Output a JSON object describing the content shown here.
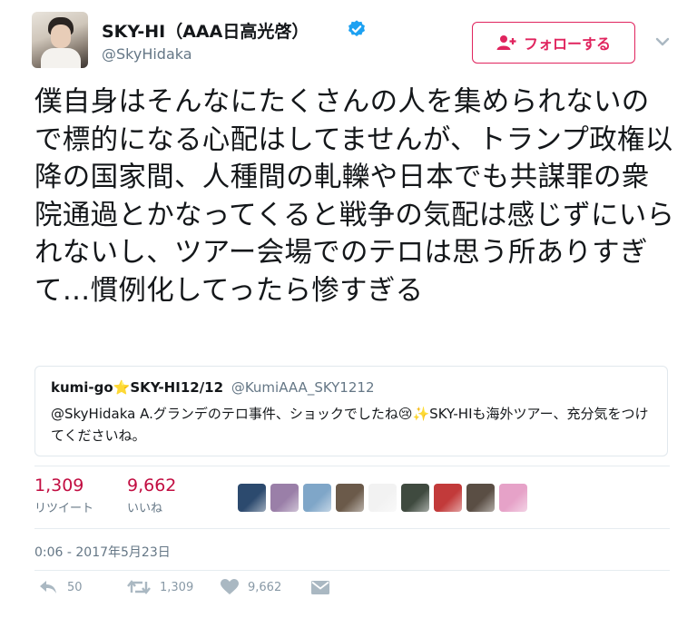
{
  "user": {
    "display_name": "SKY-HI（AAA日高光啓）",
    "handle": "@SkyHidaka",
    "verified_icon": "verified-badge-icon"
  },
  "follow_button": {
    "label": "フォローする",
    "icon": "add-user-icon"
  },
  "menu_icon": "chevron-down-icon",
  "tweet": {
    "text": "僕自身はそんなにたくさんの人を集められないので標的になる心配はしてませんが、トランプ政権以降の国家間、人種間の軋轢や日本でも共謀罪の衆院通過とかなってくると戦争の気配は感じずにいられないし、ツアー会場でのテロは思う所ありすぎて…慣例化してったら惨すぎる"
  },
  "quoted_tweet": {
    "name": "kumi-go⭐SKY-HI12/12",
    "handle": "@KumiAAA_SKY1212",
    "text": "@SkyHidaka A.グランデのテロ事件、ショックでしたね😢✨SKY-HIも海外ツアー、充分気をつけてくださいね。"
  },
  "stats": {
    "retweets": {
      "count": "1,309",
      "label": "リツイート"
    },
    "likes": {
      "count": "9,662",
      "label": "いいね"
    }
  },
  "liked_by_colors": [
    "#2c4a6e",
    "#9a7fa8",
    "#7fa6c8",
    "#6b5a4a",
    "#f2f2f2",
    "#3f4a3f",
    "#c23a3a",
    "#5a4e44",
    "#e6a2c8"
  ],
  "timestamp": "0:06 - 2017年5月23日",
  "actions": {
    "reply": {
      "icon": "reply-icon",
      "count": "50"
    },
    "retweet": {
      "icon": "retweet-icon",
      "count": "1,309"
    },
    "like": {
      "icon": "heart-icon",
      "count": "9,662"
    },
    "dm": {
      "icon": "envelope-icon"
    }
  },
  "colors": {
    "accent": "#e0245e",
    "stat_number": "#c20e42",
    "verified": "#1da1f2",
    "muted": "#657786"
  }
}
